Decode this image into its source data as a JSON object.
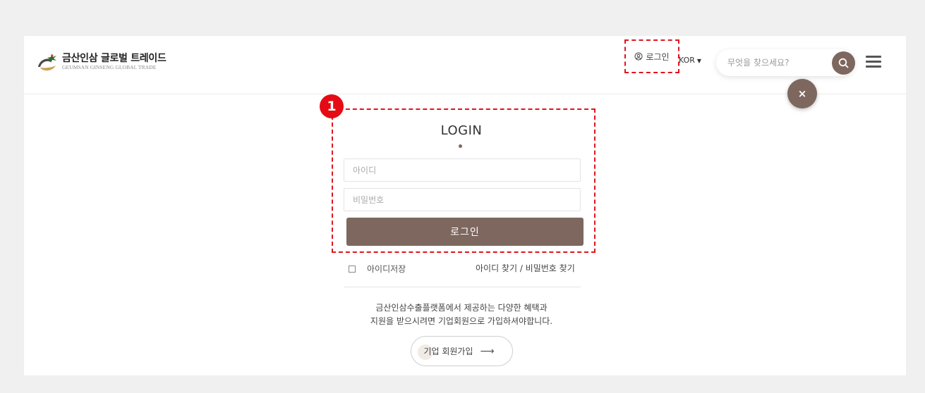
{
  "brand": {
    "name": "금산인삼 글로벌 트레이드",
    "tagline": "GEUMSAN GINSENG GLOBAL TRADE",
    "colors": {
      "primary": "#7d675e",
      "highlight": "#e0141e"
    }
  },
  "header": {
    "login_link": "로그인",
    "language": "KOR",
    "search_placeholder": "무엇을 찾으세요?",
    "icons": {
      "user": "user-circle-icon",
      "search": "search-icon",
      "menu": "hamburger-menu-icon",
      "close": "close-icon"
    },
    "close_label": "×"
  },
  "annotation": {
    "step": "1"
  },
  "login": {
    "title": "LOGIN",
    "id_placeholder": "아이디",
    "password_placeholder": "비밀번호",
    "submit": "로그인",
    "remember": "아이디저장",
    "find_links": "아이디 찾기 / 비밀번호 찾기",
    "join_desc_line1": "금산인삼수출플랫폼에서 제공하는 다양한 혜택과",
    "join_desc_line2": "지원을 받으시려면 기업회원으로 가입하셔야합니다.",
    "join_button": "기업 회원가입",
    "join_arrow": "⟶"
  }
}
